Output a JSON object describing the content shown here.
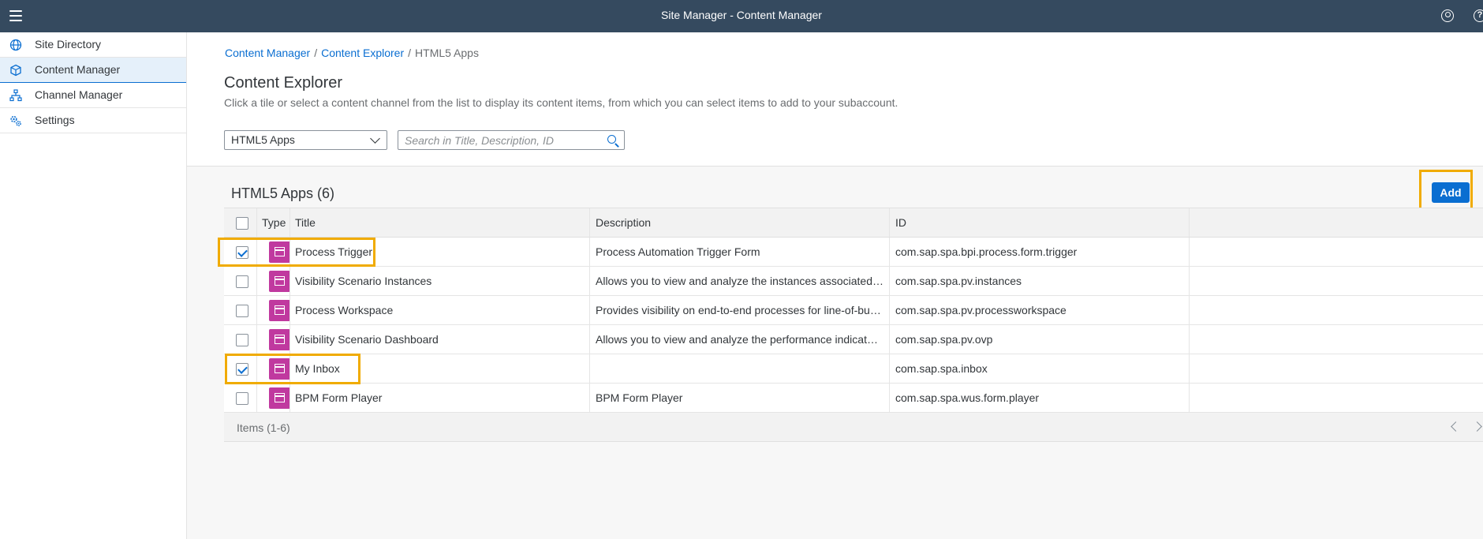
{
  "shell": {
    "title": "Site Manager - Content Manager"
  },
  "sidebar": {
    "items": [
      {
        "label": "Site Directory",
        "icon": "globe-icon"
      },
      {
        "label": "Content Manager",
        "icon": "cube-icon",
        "active": true
      },
      {
        "label": "Channel Manager",
        "icon": "hierarchy-icon"
      },
      {
        "label": "Settings",
        "icon": "gears-icon"
      }
    ]
  },
  "breadcrumb": {
    "items": [
      "Content Manager",
      "Content Explorer"
    ],
    "current": "HTML5 Apps"
  },
  "page": {
    "title": "Content Explorer",
    "subtitle": "Click a tile or select a content channel from the list to display its content items, from which you can select items to add to your subaccount."
  },
  "filter": {
    "selected": "HTML5 Apps",
    "search_placeholder": "Search in Title, Description, ID"
  },
  "table": {
    "title": "HTML5 Apps (6)",
    "add_label": "Add",
    "headers": {
      "type": "Type",
      "title": "Title",
      "description": "Description",
      "id": "ID"
    },
    "rows": [
      {
        "checked": true,
        "title": "Process Trigger",
        "description": "Process Automation Trigger Form",
        "id": "com.sap.spa.bpi.process.form.trigger"
      },
      {
        "checked": false,
        "title": "Visibility Scenario Instances",
        "description": "Allows you to view and analyze the instances associated with the pro...",
        "id": "com.sap.spa.pv.instances"
      },
      {
        "checked": false,
        "title": "Process Workspace",
        "description": "Provides visibility on end-to-end processes for line-of-business users ...",
        "id": "com.sap.spa.pv.processworkspace"
      },
      {
        "checked": false,
        "title": "Visibility Scenario Dashboard",
        "description": "Allows you to view and analyze the performance indicators for the pr...",
        "id": "com.sap.spa.pv.ovp"
      },
      {
        "checked": true,
        "title": "My Inbox",
        "description": "",
        "id": "com.sap.spa.inbox"
      },
      {
        "checked": false,
        "title": "BPM Form Player",
        "description": "BPM Form Player",
        "id": "com.sap.spa.wus.form.player"
      }
    ],
    "footer": "Items (1-6)"
  },
  "colors": {
    "shell": "#354a5f",
    "accent": "#0a6ed1",
    "highlight": "#f0ab00",
    "app_icon": "#c0399f"
  }
}
